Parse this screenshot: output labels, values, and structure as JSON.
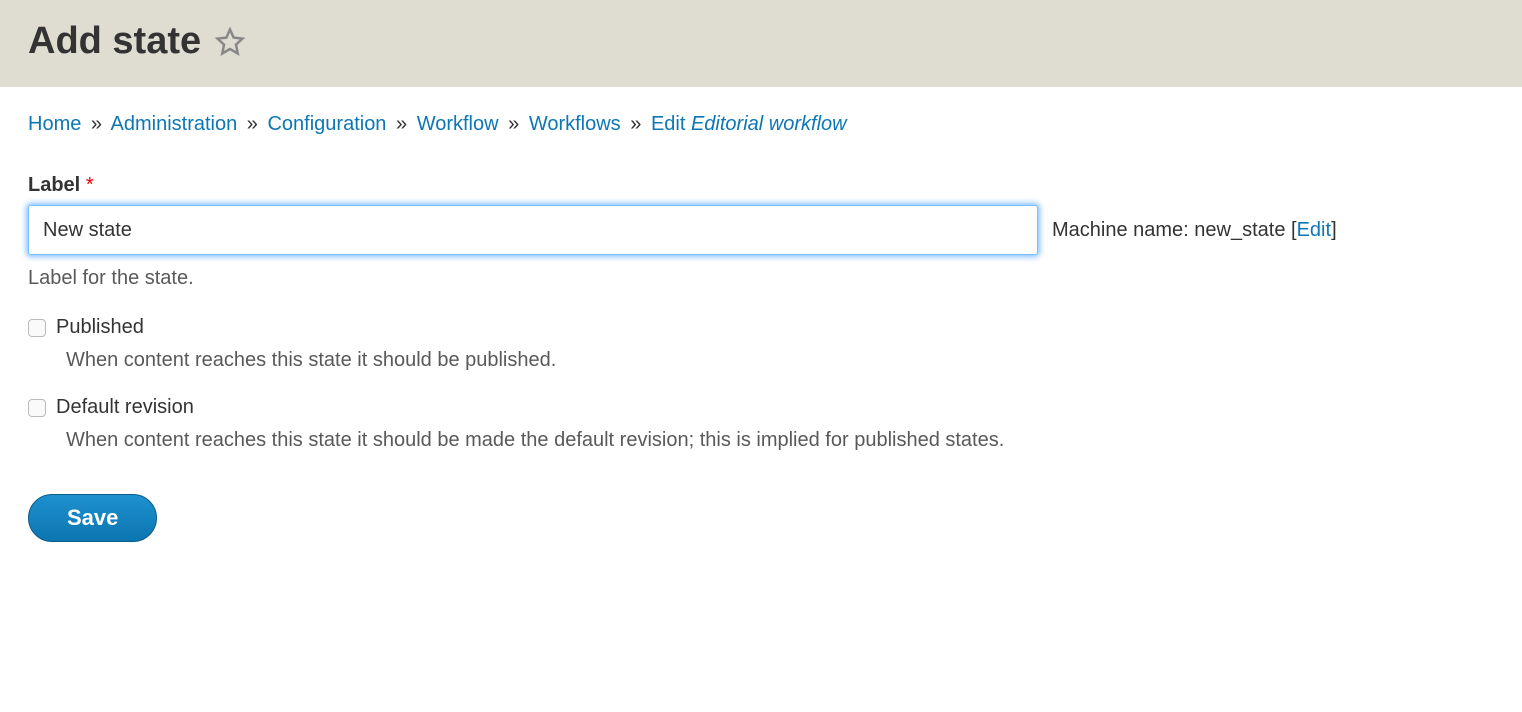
{
  "header": {
    "title": "Add state"
  },
  "breadcrumb": {
    "home": "Home",
    "administration": "Administration",
    "configuration": "Configuration",
    "workflow": "Workflow",
    "workflows": "Workflows",
    "edit_prefix": "Edit ",
    "edit_item": "Editorial workflow"
  },
  "form": {
    "label": {
      "title": "Label",
      "value": "New state",
      "description": "Label for the state.",
      "machine_name_label": "Machine name: ",
      "machine_name_value": "new_state",
      "edit_link": "Edit"
    },
    "published": {
      "label": "Published",
      "description": "When content reaches this state it should be published."
    },
    "default_revision": {
      "label": "Default revision",
      "description": "When content reaches this state it should be made the default revision; this is implied for published states."
    },
    "save_button": "Save"
  }
}
